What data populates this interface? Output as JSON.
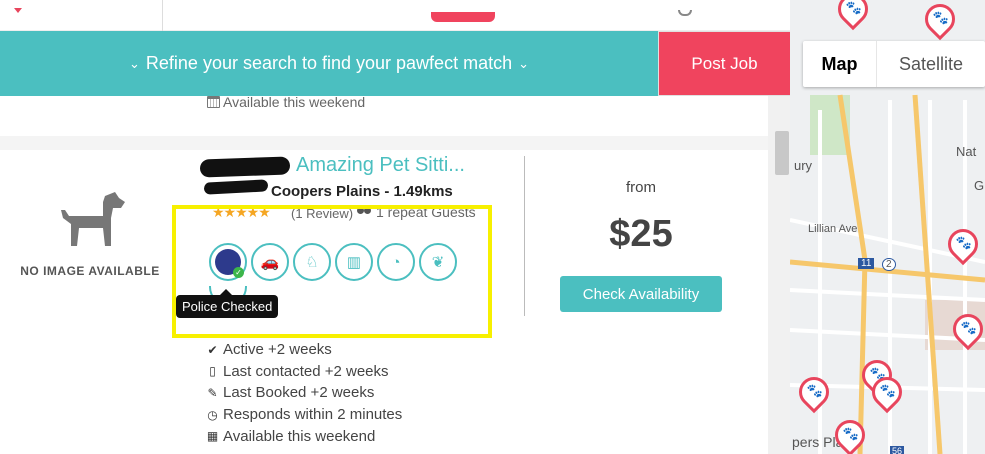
{
  "refine": {
    "label": "Refine your search to find your pawfect match",
    "chevron_left": "⌄",
    "chevron_right": "⌄"
  },
  "post_job": "Post Job",
  "previous_listing": {
    "availability": "Available this weekend"
  },
  "listing": {
    "no_image_label": "NO IMAGE AVAILABLE",
    "name": "Amazing Pet Sitti...",
    "location": "Coopers Plains - 1.49kms",
    "stars": "★★★★★",
    "rating_stars": 5,
    "review_count": "(1 Review)",
    "repeat_guests": "1 repeat Guests",
    "badges": [
      "police-checked",
      "car",
      "dog-walking",
      "fenced-yard",
      "24-hour",
      "leaves"
    ],
    "tooltip": "Police Checked",
    "stats": [
      {
        "icon": "✔",
        "text": "Active +2 weeks"
      },
      {
        "icon": "▯",
        "text": "Last contacted +2 weeks"
      },
      {
        "icon": "✎",
        "text": "Last Booked +2 weeks"
      },
      {
        "icon": "◷",
        "text": "Responds within 2 minutes"
      },
      {
        "icon": "▦",
        "text": "Available this weekend"
      }
    ],
    "price_from": "from",
    "price": "$25",
    "check_availability": "Check Availability"
  },
  "map": {
    "toggle_map": "Map",
    "toggle_satellite": "Satellite",
    "labels": [
      "ury",
      "Nat",
      "G",
      "Lillian Ave",
      "pers Plains",
      "11",
      "2",
      "56"
    ]
  },
  "colors": {
    "teal": "#4bbfc0",
    "pink": "#f0445e",
    "highlight": "#f7f000"
  }
}
